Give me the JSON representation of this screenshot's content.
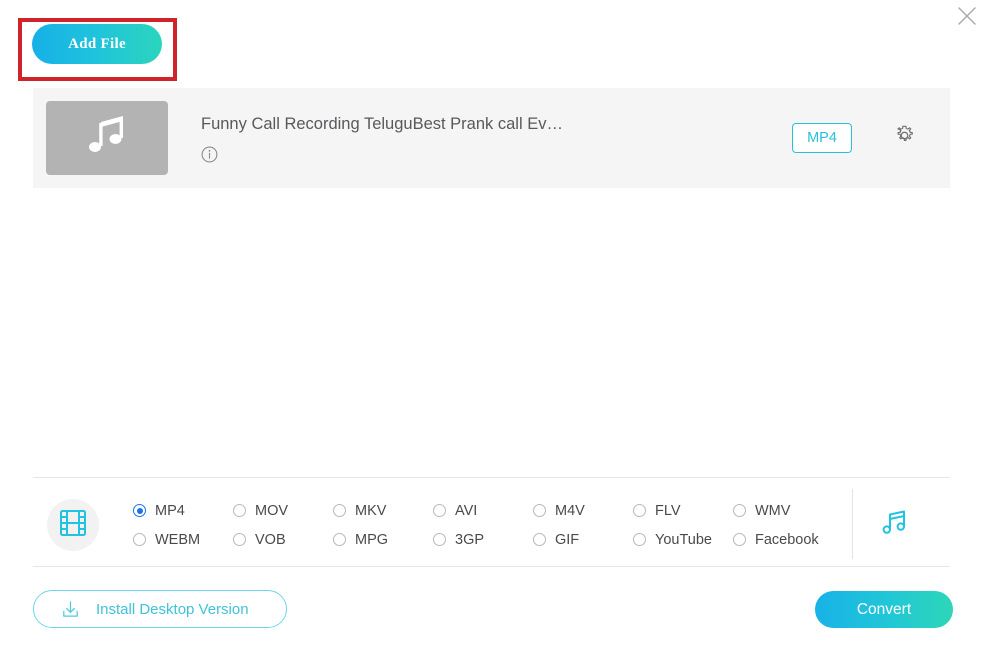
{
  "window": {
    "close_label": "×",
    "close_icon": "close-icon",
    "background": "#ffffff"
  },
  "colors": {
    "accent_cyan": "#28c0da",
    "gradient_start": "#18b2e8",
    "gradient_end": "#2dd6b8",
    "radio_selected": "#1a73e8",
    "annotation_red": "#d1232a",
    "row_background": "#f5f5f5",
    "thumb_background": "#b3b3b3"
  },
  "toolbar": {
    "add_file_label": "Add File",
    "add_file_icon": "add-file-button",
    "annotation": {
      "present": true,
      "color": "#d1232a"
    }
  },
  "file_list": [
    {
      "name": "Funny Call Recording TeluguBest Prank call Ev…",
      "thumbnail_icon": "music-note-icon",
      "info_icon": "info-icon",
      "format_badge": "MP4",
      "settings_icon": "gear-icon"
    }
  ],
  "format_panel": {
    "type_icon": "film-strip-icon",
    "audio_tab_icon": "music-note-icon",
    "selected": "MP4",
    "options": [
      {
        "label": "MP4",
        "selected": true
      },
      {
        "label": "MOV",
        "selected": false
      },
      {
        "label": "MKV",
        "selected": false
      },
      {
        "label": "AVI",
        "selected": false
      },
      {
        "label": "M4V",
        "selected": false
      },
      {
        "label": "FLV",
        "selected": false
      },
      {
        "label": "WMV",
        "selected": false
      },
      {
        "label": "WEBM",
        "selected": false
      },
      {
        "label": "VOB",
        "selected": false
      },
      {
        "label": "MPG",
        "selected": false
      },
      {
        "label": "3GP",
        "selected": false
      },
      {
        "label": "GIF",
        "selected": false
      },
      {
        "label": "YouTube",
        "selected": false
      },
      {
        "label": "Facebook",
        "selected": false
      }
    ]
  },
  "footer": {
    "install_label": "Install Desktop Version",
    "install_icon": "download-icon",
    "convert_label": "Convert"
  }
}
